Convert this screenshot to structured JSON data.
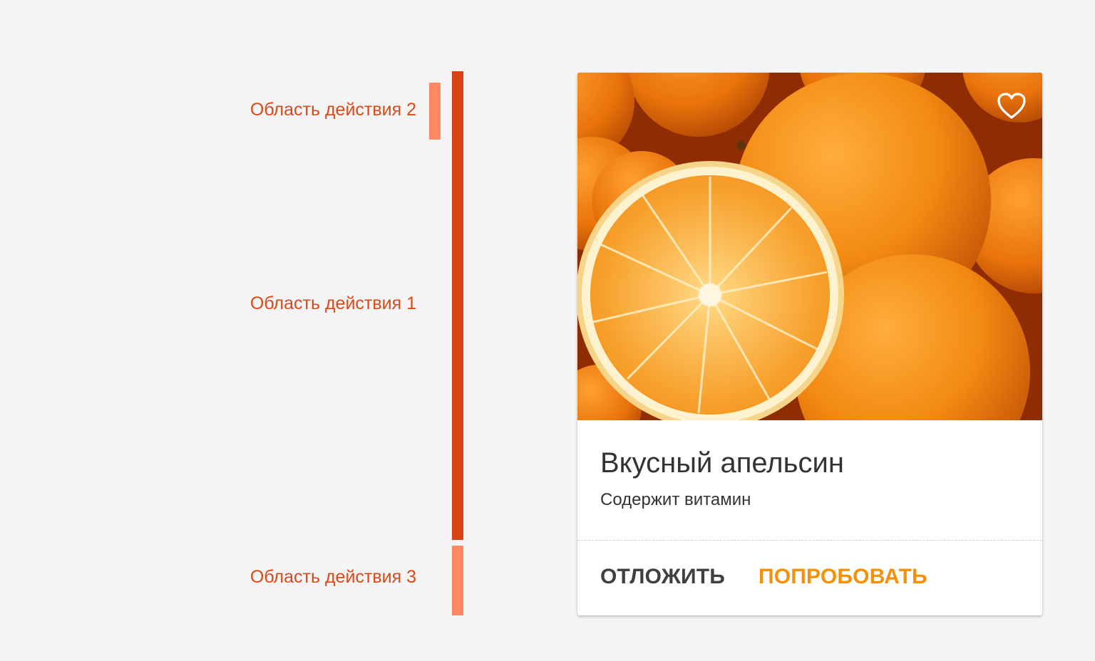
{
  "annotations": {
    "area_2": "Область действия 2",
    "area_1": "Область действия 1",
    "area_3": "Область действия 3",
    "colors": {
      "label": "#d84a1b",
      "primary_bar": "#d84315",
      "secondary_bar": "#ff8a65"
    }
  },
  "card": {
    "image": "oranges-photo",
    "favorite_icon": "heart-outline-icon",
    "title": "Вкусный апельсин",
    "subtitle": "Содержит витамин",
    "actions": {
      "secondary_label": "ОТЛОЖИТЬ",
      "primary_label": "ПОПРОБОВАТЬ"
    },
    "colors": {
      "primary_action": "#f5900a",
      "secondary_action": "#404040"
    }
  }
}
